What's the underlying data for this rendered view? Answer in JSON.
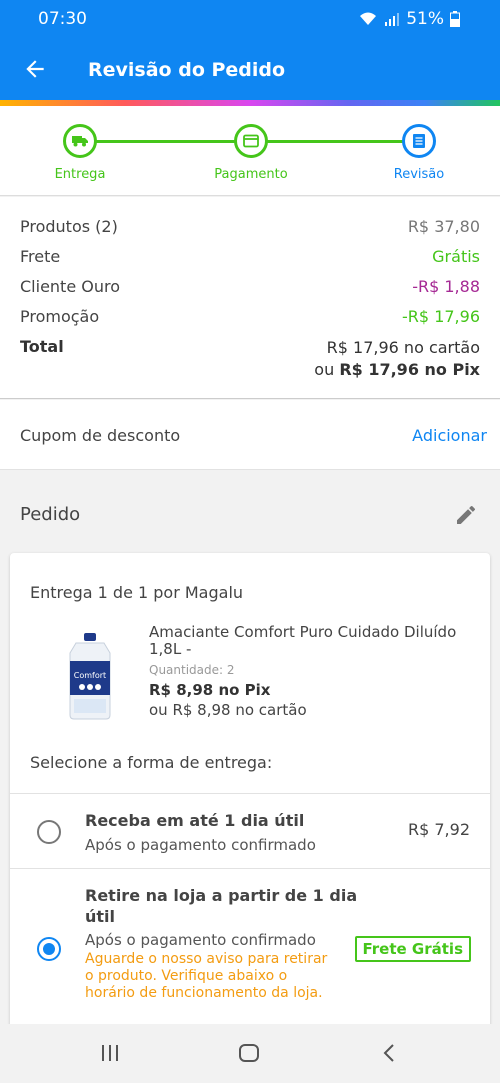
{
  "status_bar": {
    "time": "07:30",
    "battery": "51%"
  },
  "app_bar": {
    "title": "Revisão do Pedido"
  },
  "stepper": {
    "steps": [
      {
        "label": "Entrega",
        "state": "done"
      },
      {
        "label": "Pagamento",
        "state": "done"
      },
      {
        "label": "Revisão",
        "state": "current"
      }
    ]
  },
  "summary": {
    "produtos_label": "Produtos (2)",
    "produtos_value": "R$ 37,80",
    "frete_label": "Frete",
    "frete_value": "Grátis",
    "cliente_ouro_label": "Cliente Ouro",
    "cliente_ouro_value": "-R$ 1,88",
    "promocao_label": "Promoção",
    "promocao_value": "-R$ 17,96",
    "total_label": "Total",
    "total_card": "R$ 17,96 no cartão",
    "total_pix_prefix": "ou",
    "total_pix": "R$ 17,96 no Pix"
  },
  "coupon": {
    "label": "Cupom de desconto",
    "action": "Adicionar"
  },
  "pedido": {
    "title": "Pedido",
    "entrega": "Entrega 1 de 1 por Magalu",
    "product": {
      "name": "Amaciante Comfort Puro Cuidado Diluído 1,8L -",
      "quantity_label": "Quantidade:",
      "quantity": "2",
      "price_pix": "R$ 8,98 no Pix",
      "price_card": "ou R$ 8,98 no cartão",
      "brand": "Comfort"
    },
    "select_title": "Selecione a forma de entrega:",
    "options": [
      {
        "title": "Receba em até 1 dia útil",
        "subtitle": "Após o pagamento confirmado",
        "price": "R$ 7,92",
        "selected": false
      },
      {
        "title": "Retire na loja a partir de 1 dia útil",
        "subtitle": "Após o pagamento confirmado",
        "badge": "Frete Grátis",
        "warning": "Aguarde o nosso aviso para retirar o produto. Verifique abaixo o horário de funcionamento da loja.",
        "selected": true
      }
    ]
  },
  "colors": {
    "primary": "#0f86f2",
    "green": "#45c51a",
    "purple": "#a52994",
    "orange": "#f39c12"
  },
  "icons": [
    "wifi-icon",
    "signal-icon",
    "battery-icon",
    "back-arrow-icon",
    "truck-icon",
    "card-icon",
    "document-icon",
    "pencil-icon",
    "recent-apps-icon",
    "home-icon",
    "nav-back-icon"
  ]
}
